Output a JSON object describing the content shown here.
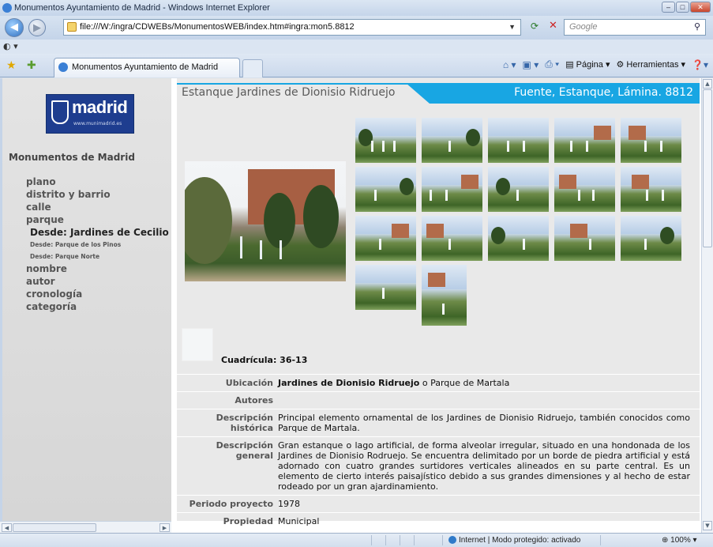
{
  "browser": {
    "window_title": "Monumentos Ayuntamiento de Madrid - Windows Internet Explorer",
    "address": "file:///W:/ingra/CDWEBs/MonumentosWEB/index.htm#ingra:mon5.8812",
    "search_placeholder": "Google",
    "tab_title": "Monumentos Ayuntamiento de Madrid",
    "cmd": {
      "page": "Página",
      "tools": "Herramientas"
    },
    "status_zone": "Internet | Modo protegido: activado",
    "zoom": "100%"
  },
  "sidebar": {
    "logo_word": "madrid",
    "logo_url": "www.munimadrid.es",
    "title": "Monumentos de Madrid",
    "items": [
      {
        "label": "plano",
        "level": 0
      },
      {
        "label": "distrito y barrio",
        "level": 0
      },
      {
        "label": "calle",
        "level": 0
      },
      {
        "label": "parque",
        "level": 0
      },
      {
        "label": "Desde: Jardines de Cecilio Rodríguez",
        "level": 1
      },
      {
        "label": "Desde: Parque de los Pinos",
        "level": 2
      },
      {
        "label": "Desde: Parque Norte",
        "level": 2
      },
      {
        "label": "nombre",
        "level": 0
      },
      {
        "label": "autor",
        "level": 0
      },
      {
        "label": "cronología",
        "level": 0
      },
      {
        "label": "categoría",
        "level": 0
      }
    ]
  },
  "content": {
    "title": "Estanque Jardines de Dionisio Ridruejo",
    "category": "Fuente, Estanque, Lámina. 8812",
    "cuadricula": "Cuadrícula: 36-13",
    "rows": [
      {
        "key": "Ubicación",
        "bold": "Jardines de Dionisio Ridruejo",
        "value": " o Parque de Martala"
      },
      {
        "key": "Autores",
        "bold": "",
        "value": ""
      },
      {
        "key": "Descripción histórica",
        "bold": "",
        "value": "Principal elemento ornamental de los Jardines de Dionisio Ridruejo, también conocidos como Parque de Martala."
      },
      {
        "key": "Descripción general",
        "bold": "",
        "value": "Gran estanque o lago artificial, de forma alveolar irregular, situado en una hondonada de los Jardines de Dionisio Rodruejo. Se encuentra delimitado por un borde de piedra artificial y está adornado con cuatro grandes surtidores verticales alineados en su parte central. Es un elemento de cierto interés paisajístico debido a sus grandes dimensiones y al hecho de estar rodeado por un gran ajardinamiento."
      },
      {
        "key": "Periodo proyecto",
        "bold": "",
        "value": "1978"
      },
      {
        "key": "Propiedad",
        "bold": "",
        "value": "Municipal"
      }
    ]
  }
}
